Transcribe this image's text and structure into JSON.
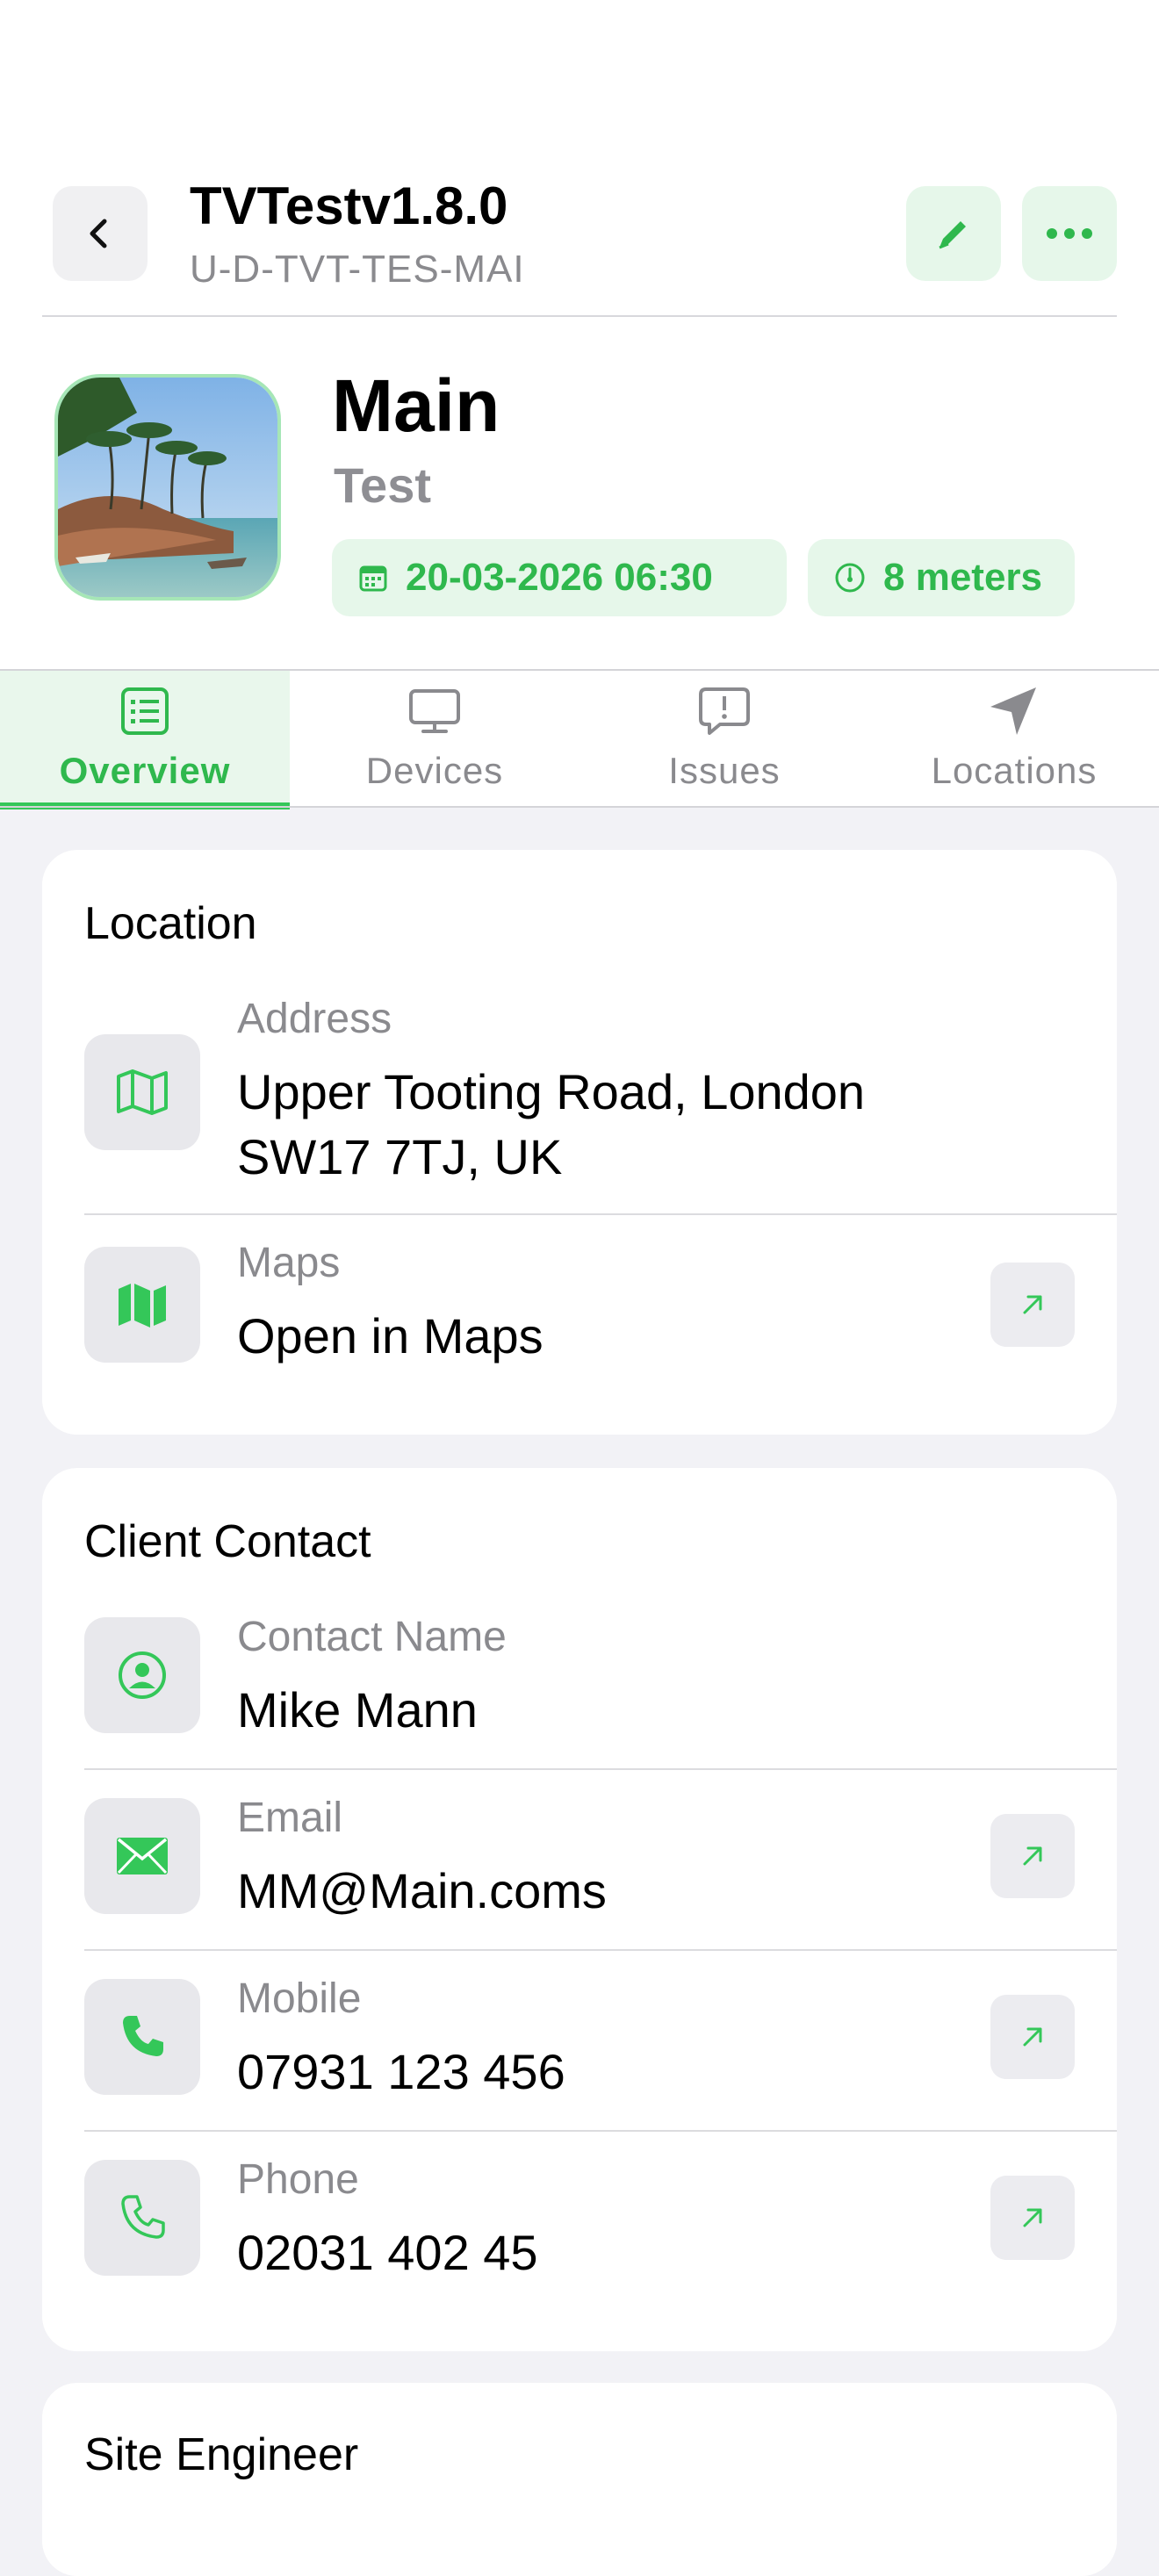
{
  "header": {
    "title": "TVTestv1.8.0",
    "subtitle": "U-D-TVT-TES-MAI"
  },
  "site": {
    "name": "Main",
    "sub": "Test",
    "datetime": "20-03-2026 06:30",
    "distance": "8 meters"
  },
  "tabs": [
    {
      "label": "Overview",
      "icon": "list-icon",
      "active": true
    },
    {
      "label": "Devices",
      "icon": "monitor-icon"
    },
    {
      "label": "Issues",
      "icon": "alert-bubble-icon"
    },
    {
      "label": "Locations",
      "icon": "location-arrow-icon"
    }
  ],
  "location": {
    "title": "Location",
    "address_label": "Address",
    "address_line1": "Upper Tooting Road, London",
    "address_line2": "SW17 7TJ, UK",
    "maps_label": "Maps",
    "maps_value": "Open in Maps"
  },
  "client": {
    "title": "Client Contact",
    "contact_label": "Contact Name",
    "contact_value": "Mike Mann",
    "email_label": "Email",
    "email_value": "MM@Main.coms",
    "mobile_label": "Mobile",
    "mobile_value": "07931 123 456",
    "phone_label": "Phone",
    "phone_value": "02031 402 45"
  },
  "engineer": {
    "title": "Site Engineer"
  },
  "colors": {
    "accent": "#34c759",
    "accent_text": "#2fb84d",
    "accent_bg": "#e6f7ea",
    "background": "#f2f2f6"
  }
}
